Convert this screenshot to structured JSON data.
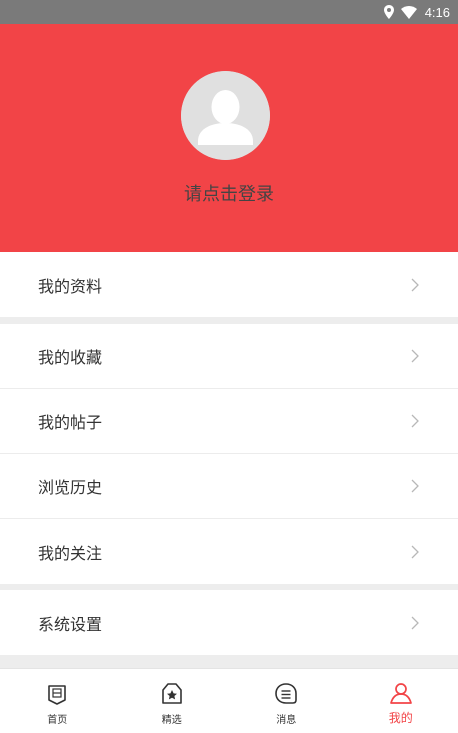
{
  "status_bar": {
    "time": "4:16",
    "icons": [
      "location-icon",
      "wifi-icon"
    ]
  },
  "profile": {
    "login_prompt": "请点击登录",
    "avatar_icon": "default-avatar-icon"
  },
  "menu": {
    "group1": [
      {
        "label": "我的资料"
      }
    ],
    "group2": [
      {
        "label": "我的收藏"
      },
      {
        "label": "我的帖子"
      },
      {
        "label": "浏览历史"
      },
      {
        "label": "我的关注"
      }
    ],
    "group3": [
      {
        "label": "系统设置"
      }
    ]
  },
  "tab_bar": {
    "tabs": [
      {
        "label": "首页",
        "icon": "home-icon"
      },
      {
        "label": "精选",
        "icon": "featured-icon"
      },
      {
        "label": "消息",
        "icon": "message-icon"
      },
      {
        "label": "我的",
        "icon": "profile-icon",
        "active": true
      }
    ]
  },
  "colors": {
    "brand_red": "#f24447",
    "header_bg": "#f24447",
    "page_bg": "#ededed",
    "status_bar_bg": "#7a7a7a"
  }
}
